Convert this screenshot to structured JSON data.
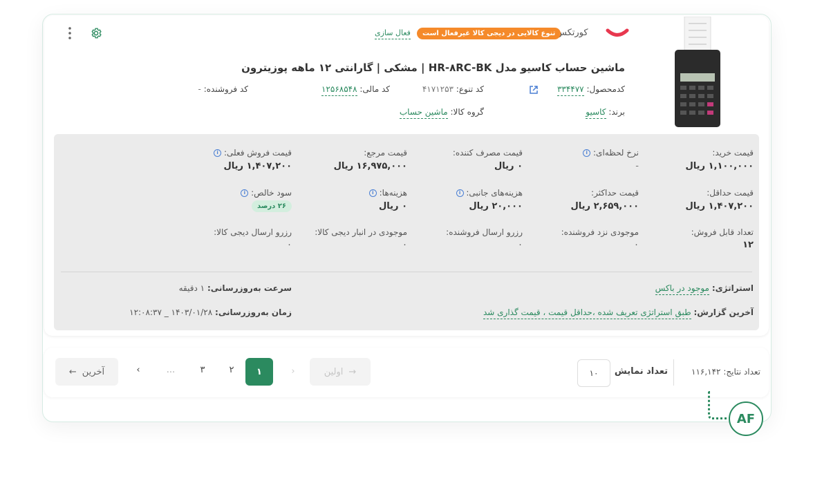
{
  "header": {
    "brand_name": "کورتکس",
    "variant_badge": "تنوع کالایی در دیجی کالا غیرفعال است",
    "activate_link": "فعال سازی",
    "product_title": "ماشین حساب کاسیو مدل HR-۸RC-BK | مشکی | گارانتی ۱۲ ماهه پوزیترون",
    "product_code_label": "کدمحصول:",
    "product_code_value": "۳۳۴۴۷۷",
    "variant_code_label": "کد تنوع:",
    "variant_code_value": "۴۱۷۱۲۵۳",
    "fiscal_code_label": "کد مالی:",
    "fiscal_code_value": "۱۲۵۶۸۵۴۸",
    "seller_code_label": "کد فروشنده:",
    "seller_code_value": "-",
    "brand_label": "برند:",
    "brand_value": "کاسیو",
    "group_label": "گروه کالا:",
    "group_value": "ماشین حساب"
  },
  "prices": {
    "buy_label": "قیمت خرید:",
    "buy_value": "۱,۱۰۰,۰۰۰ ریال",
    "instant_rate_label": "نرخ لحظه‌ای:",
    "instant_rate_value": "-",
    "consumer_label": "قیمت مصرف کننده:",
    "consumer_value": "۰ ریال",
    "reference_label": "قیمت مرجع:",
    "reference_value": "۱۶,۹۷۵,۰۰۰ ریال",
    "current_sell_label": "قیمت فروش فعلی:",
    "current_sell_value": "۱,۴۰۷,۲۰۰ ریال",
    "min_label": "قیمت حداقل:",
    "min_value": "۱,۴۰۷,۲۰۰ ریال",
    "max_label": "قیمت حداکثر:",
    "max_value": "۲,۶۵۹,۰۰۰ ریال",
    "side_costs_label": "هزینه‌های جانبی:",
    "side_costs_value": "۲۰,۰۰۰ ریال",
    "costs_label": "هزینه‌ها:",
    "costs_value": "۰ ریال",
    "net_profit_label": "سود خالص:",
    "net_profit_value": "۲۶ درصد",
    "sellable_label": "تعداد قابل فروش:",
    "sellable_value": "۱۲",
    "seller_stock_label": "موجودی نزد فروشنده:",
    "seller_stock_value": "۰",
    "seller_reserve_label": "رزرو ارسال فروشنده:",
    "seller_reserve_value": "۰",
    "dk_warehouse_label": "موجودی در انبار دیجی کالا:",
    "dk_warehouse_value": "۰",
    "dk_reserve_label": "رزرو ارسال دیجی کالا:",
    "dk_reserve_value": "۰"
  },
  "strategy": {
    "strategy_label": "استراتژی:",
    "strategy_value": "موجود در باکس",
    "last_report_label": "آخرین گزارش:",
    "last_report_value": "طبق استراتژی تعریف شده ،حداقل قیمت ، قیمت گذاری شد",
    "update_speed_label": "سرعت به‌روزرسانی:",
    "update_speed_value": "۱ دقیقه",
    "update_time_label": "زمان به‌روزرسانی:",
    "update_time_value": "۱۴۰۳/۰۱/۲۸ _ ۱۲:۰۸:۳۷"
  },
  "pagination": {
    "results_label": "تعداد نتایج:",
    "results_value": "۱۱۶,۱۴۲",
    "display_count_label": "تعداد نمایش",
    "display_count_value": "۱۰",
    "first_label": "اولین",
    "last_label": "آخرین",
    "pages": [
      "۱",
      "۲",
      "۳"
    ],
    "ellipsis": "...",
    "active_page": "۱"
  },
  "badge": {
    "af_label": "AF"
  },
  "colors": {
    "accent": "#2b8a5f",
    "warning": "#f58a2a",
    "panel": "#ebebeb",
    "info": "#4a7fd4"
  },
  "icons": [
    "settings-gear-icon",
    "kebab-menu-icon",
    "external-link-icon",
    "info-icon",
    "arrow-right-icon",
    "arrow-left-icon",
    "chevron-right-icon",
    "chevron-left-icon"
  ]
}
